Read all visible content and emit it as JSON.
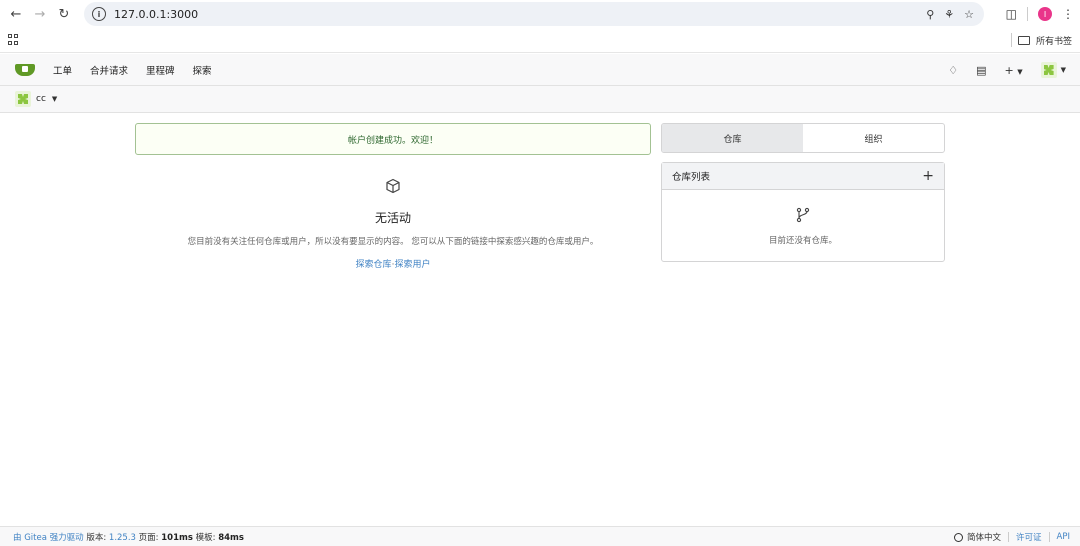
{
  "browser": {
    "url": "127.0.0.1:3000",
    "profile_initial": "I",
    "bookmarks_label": "所有书签"
  },
  "nav": {
    "items": [
      "工单",
      "合并请求",
      "里程碑",
      "探索"
    ]
  },
  "context": {
    "user": "cc"
  },
  "flash": {
    "message": "帐户创建成功。欢迎！"
  },
  "feed": {
    "title": "无活动",
    "description": "您目前没有关注任何仓库或用户，所以没有要显示的内容。 您可以从下面的链接中探索感兴趣的仓库或用户。",
    "link_repos": "探索仓库",
    "separator": "·",
    "link_users": "探索用户"
  },
  "dashboard": {
    "tabs": [
      "仓库",
      "组织"
    ],
    "repo_list_title": "仓库列表",
    "repo_empty": "目前还没有仓库。"
  },
  "footer": {
    "powered_prefix": "由 Gitea 强力驱动",
    "version_label": "版本:",
    "version": "1.25.3",
    "page_label": "页面:",
    "page_time": "101ms",
    "template_label": "模板:",
    "template_time": "84ms",
    "language": "简体中文",
    "license": "许可证",
    "api": "API"
  }
}
